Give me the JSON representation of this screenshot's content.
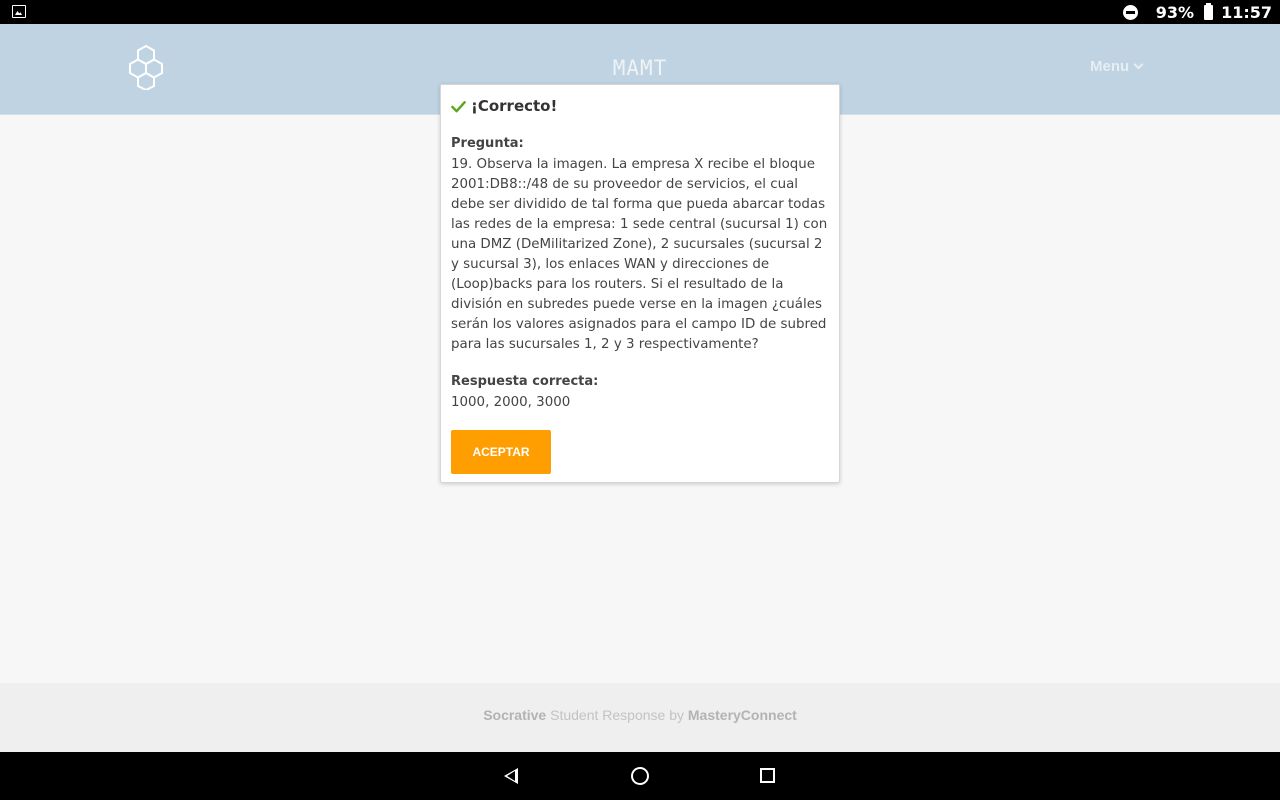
{
  "status_bar": {
    "battery": "93%",
    "time": "11:57"
  },
  "header": {
    "title": "MAMT",
    "menu_label": "Menu"
  },
  "modal": {
    "title": "¡Correcto!",
    "question_label": "Pregunta:",
    "question_text": "19. Observa la imagen. La empresa X recibe el bloque 2001:DB8::/48 de su proveedor de servicios, el cual debe ser dividido de tal forma que pueda abarcar todas las redes de la empresa: 1 sede central (sucursal 1) con una DMZ (DeMilitarized Zone), 2 sucursales (sucursal 2 y sucursal 3), los enlaces WAN y direcciones de (Loop)backs para los routers. Si el resultado de la división en subredes puede verse en la imagen ¿cuáles serán los valores asignados para el campo ID de subred para las sucursales 1, 2 y 3 respectivamente?",
    "answer_label": "Respuesta correcta:",
    "answer_text": "1000, 2000, 3000",
    "accept_label": "ACEPTAR",
    "accent_color": "#ff9e00",
    "check_color": "#5fa51c"
  },
  "footer": {
    "brand": "Socrative",
    "middle": " Student Response by ",
    "company": "MasteryConnect"
  },
  "icons": {
    "status_left": "image-notification-icon",
    "status_dnd": "do-not-disturb-icon",
    "status_battery": "battery-icon",
    "logo": "hexagon-logo-icon",
    "menu": "chevron-down-icon",
    "nav": [
      "back-icon",
      "home-icon",
      "recent-apps-icon"
    ]
  }
}
